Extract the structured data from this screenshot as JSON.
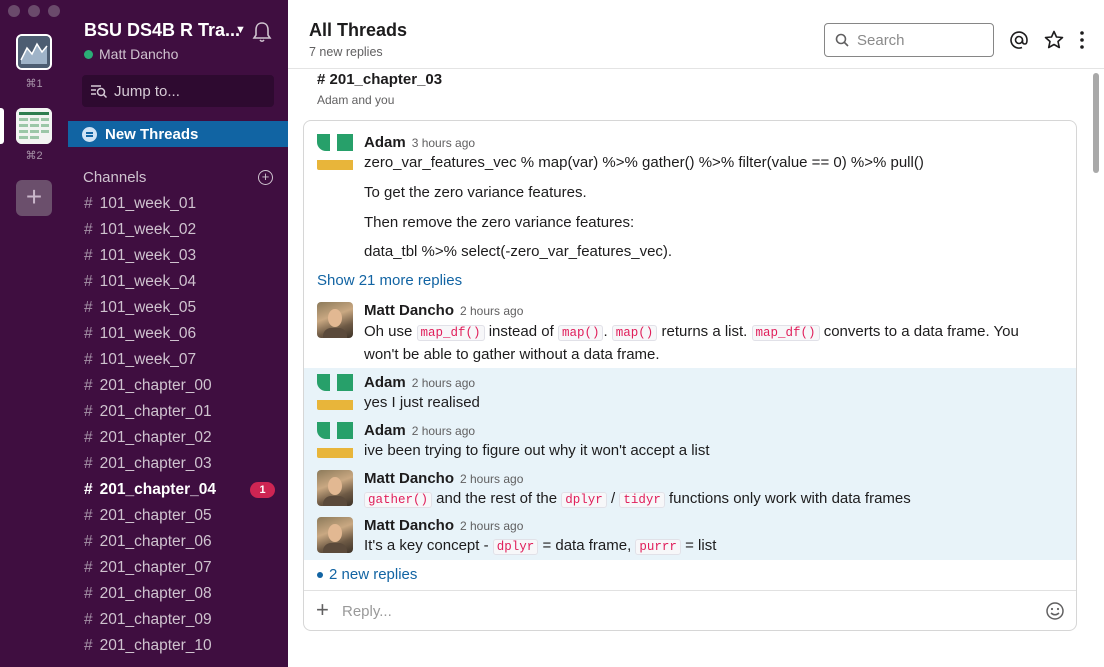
{
  "rail": {
    "shortcut1": "⌘1",
    "shortcut2": "⌘2"
  },
  "sidebar": {
    "workspace_name": "BSU DS4B R Tra...",
    "user_name": "Matt Dancho",
    "jump_to": "Jump to...",
    "new_threads": "New Threads",
    "channels_header": "Channels",
    "channels": [
      {
        "name": "101_week_01"
      },
      {
        "name": "101_week_02"
      },
      {
        "name": "101_week_03"
      },
      {
        "name": "101_week_04"
      },
      {
        "name": "101_week_05"
      },
      {
        "name": "101_week_06"
      },
      {
        "name": "101_week_07"
      },
      {
        "name": "201_chapter_00"
      },
      {
        "name": "201_chapter_01"
      },
      {
        "name": "201_chapter_02"
      },
      {
        "name": "201_chapter_03"
      },
      {
        "name": "201_chapter_04",
        "badge": "1"
      },
      {
        "name": "201_chapter_05"
      },
      {
        "name": "201_chapter_06"
      },
      {
        "name": "201_chapter_07"
      },
      {
        "name": "201_chapter_08"
      },
      {
        "name": "201_chapter_09"
      },
      {
        "name": "201_chapter_10"
      }
    ]
  },
  "header": {
    "title": "All Threads",
    "subtitle": "7 new replies",
    "search_placeholder": "Search"
  },
  "thread": {
    "channel": "# 201_chapter_03",
    "members": "Adam and you",
    "show_more": "Show 21 more replies",
    "new_replies": "2 new replies",
    "reply_placeholder": "Reply...",
    "messages": [
      {
        "author": "Adam",
        "time": "3 hours ago",
        "lines": [
          "zero_var_features_vec % map(var) %>% gather() %>% filter(value == 0) %>% pull()",
          "To get the zero variance features.",
          "Then remove the zero variance features:",
          "data_tbl %>% select(-zero_var_features_vec)."
        ]
      },
      {
        "author": "Matt Dancho",
        "time": "2 hours ago",
        "parts": {
          "t1": "Oh use ",
          "c1": "map_df()",
          "t2": " instead of ",
          "c2": "map()",
          "t3": ". ",
          "c3": "map()",
          "t4": " returns a list. ",
          "c4": "map_df()",
          "t5": " converts to a data frame. You won't be able to gather without a data frame."
        }
      },
      {
        "author": "Adam",
        "time": "2 hours ago",
        "text": "yes I just realised"
      },
      {
        "author": "Adam",
        "time": "2 hours ago",
        "text": "ive been trying to figure out why it won't accept a list"
      },
      {
        "author": "Matt Dancho",
        "time": "2 hours ago",
        "parts": {
          "c1": "gather()",
          "t1": " and the rest of the ",
          "c2": "dplyr",
          "t2": " / ",
          "c3": "tidyr",
          "t3": " functions only work with data frames"
        }
      },
      {
        "author": "Matt Dancho",
        "time": "2 hours ago",
        "parts": {
          "t1": "It's a key concept - ",
          "c1": "dplyr",
          "t2": " = data frame, ",
          "c2": "purrr",
          "t3": " = list"
        }
      }
    ]
  }
}
